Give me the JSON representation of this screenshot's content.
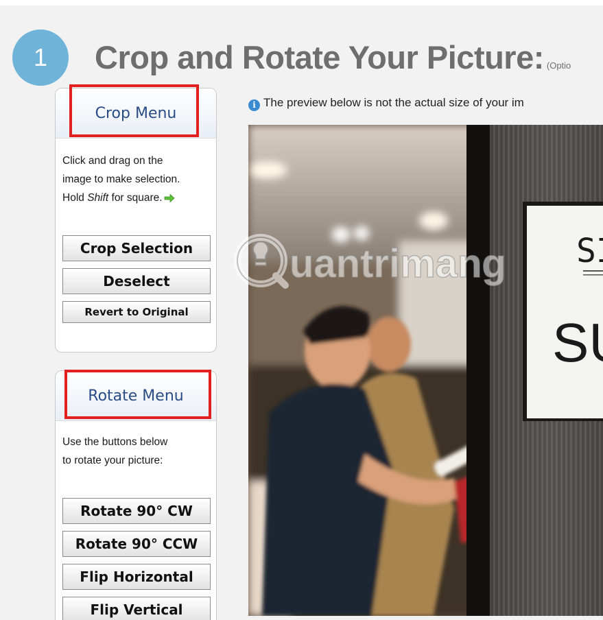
{
  "step": {
    "number": "1"
  },
  "header": {
    "title": "Crop and Rotate Your Picture:",
    "optional_note": "(Optio"
  },
  "crop_menu": {
    "title": "Crop Menu",
    "instructions_line1": "Click and drag on the",
    "instructions_line2": "image to make selection.",
    "instructions_line3_pre": "Hold ",
    "instructions_line3_em": "Shift",
    "instructions_line3_post": " for square.",
    "buttons": {
      "crop_selection": "Crop Selection",
      "deselect": "Deselect",
      "revert": "Revert to Original"
    }
  },
  "rotate_menu": {
    "title": "Rotate Menu",
    "instructions_line1": "Use the buttons below",
    "instructions_line2": "to rotate your picture:",
    "buttons": {
      "rotate_cw": "Rotate 90° CW",
      "rotate_ccw": "Rotate 90° CCW",
      "flip_horizontal": "Flip Horizontal",
      "flip_vertical": "Flip Vertical"
    }
  },
  "preview": {
    "info_text": "The preview below is not the actual size of your im",
    "sign_text_top": "SI",
    "sign_text_main": "SU"
  },
  "watermark": {
    "text": "uantrimang"
  },
  "colors": {
    "badge": "#6fb3d8",
    "title_gray": "#6e6e6e",
    "menu_title": "#2a4c86",
    "highlight_red": "#e32020",
    "info_blue": "#3a8ad0"
  },
  "icons": {
    "info": "info-icon",
    "arrow": "green-arrow-right-icon",
    "watermark_logo": "lightbulb-q-icon"
  }
}
